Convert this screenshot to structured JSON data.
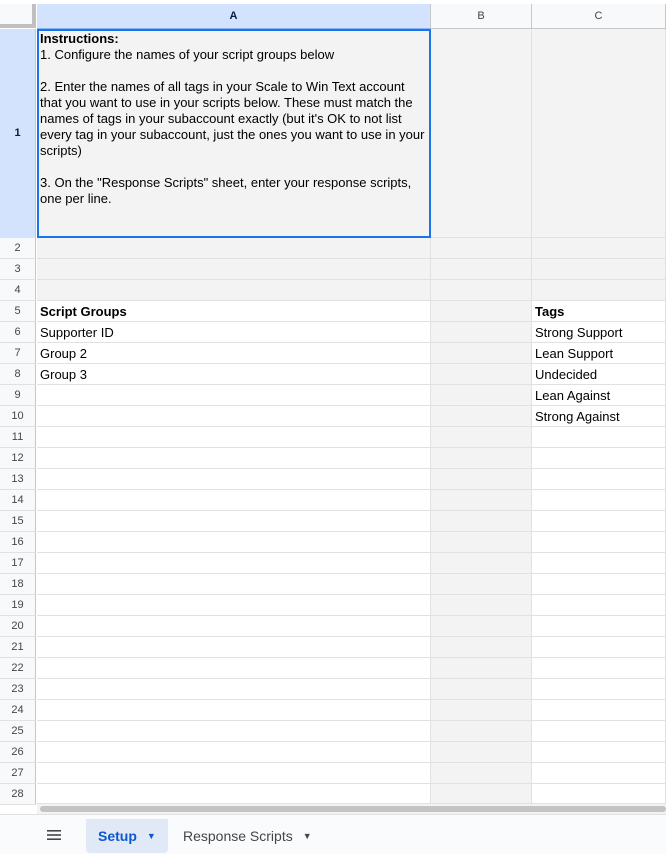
{
  "columns": [
    "A",
    "B",
    "C"
  ],
  "selected_column": "A",
  "selected_row": "1",
  "instructions": {
    "heading": "Instructions:",
    "body": "\n1. Configure the names of your script groups below\n\n2. Enter the names of all tags in your Scale to Win Text account that you want to use in your scripts below. These must match the names of tags in your subaccount exactly (but it's OK to not list every tag in your subaccount, just the ones you want to use in your scripts)\n\n3. On the \"Response Scripts\" sheet, enter your response scripts, one per line."
  },
  "rows": [
    "1",
    "2",
    "3",
    "4",
    "5",
    "6",
    "7",
    "8",
    "9",
    "10",
    "11",
    "12",
    "13",
    "14",
    "15",
    "16",
    "17",
    "18",
    "19",
    "20",
    "21",
    "22",
    "23",
    "24",
    "25",
    "26",
    "27",
    "28"
  ],
  "script_groups": {
    "header": "Script Groups",
    "items": [
      "Supporter ID",
      "Group 2",
      "Group 3"
    ]
  },
  "tags": {
    "header": "Tags",
    "items": [
      "Strong Support",
      "Lean Support",
      "Undecided",
      "Lean Against",
      "Strong Against"
    ]
  },
  "tabs": [
    {
      "label": "Setup",
      "active": true
    },
    {
      "label": "Response Scripts",
      "active": false
    }
  ],
  "colors": {
    "accent": "#0b57d0",
    "selection_border": "#1a73e8",
    "grey_fill": "#f3f3f3"
  },
  "icons": {
    "all_sheets": "menu-icon",
    "tab_menu": "caret-down-icon"
  }
}
